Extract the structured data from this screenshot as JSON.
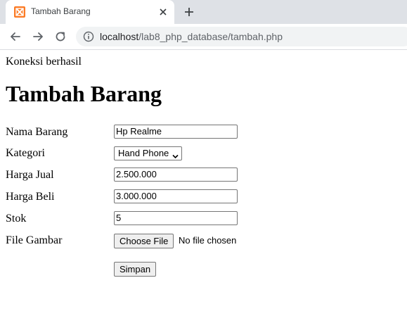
{
  "browser": {
    "tab_title": "Tambah Barang",
    "url_host": "localhost",
    "url_path": "/lab8_php_database/tambah.php",
    "favicon_color": "#fb7a24"
  },
  "page": {
    "status": "Koneksi berhasil",
    "title": "Tambah Barang"
  },
  "form": {
    "fields": [
      {
        "label": "Nama Barang",
        "value": "Hp Realme"
      },
      {
        "label": "Kategori",
        "value": "Hand Phone"
      },
      {
        "label": "Harga Jual",
        "value": "2.500.000"
      },
      {
        "label": "Harga Beli",
        "value": "3.000.000"
      },
      {
        "label": "Stok",
        "value": "5"
      },
      {
        "label": "File Gambar",
        "button": "Choose File",
        "status": "No file chosen"
      }
    ],
    "submit_label": "Simpan"
  }
}
